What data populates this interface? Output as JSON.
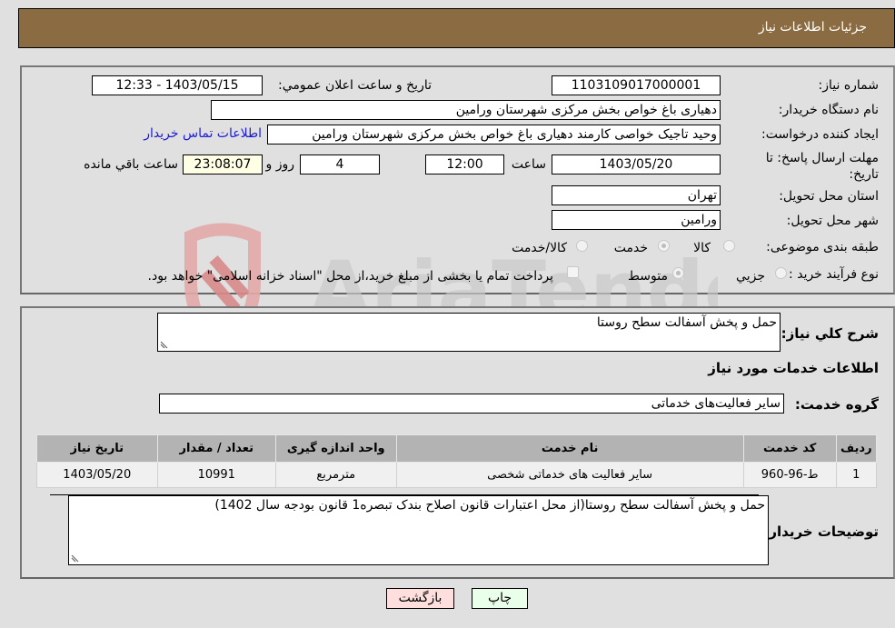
{
  "header": {
    "title": "جزئیات اطلاعات نیاز"
  },
  "fields": {
    "need_number": {
      "label": "شماره نیاز:",
      "value": "1103109017000001"
    },
    "announce_datetime": {
      "label": "تاریخ و ساعت اعلان عمومي:",
      "value": "1403/05/15 - 12:33"
    },
    "buyer_org": {
      "label": "نام دستگاه خريدار:",
      "value": "دهیاری باغ خواص بخش مرکزی شهرستان ورامین"
    },
    "requester": {
      "label": "ايجاد کننده درخواست:",
      "value": "وحید تاجیک خواصی کارمند دهیاری باغ خواص بخش مرکزی شهرستان ورامین"
    },
    "buyer_contact_link": "اطلاعات تماس خريدار",
    "deadline": {
      "label": "مهلت ارسال پاسخ: تا تاريخ:",
      "date": "1403/05/20",
      "time_label": "ساعت",
      "time": "12:00",
      "days": "4",
      "days_label": "روز و",
      "remaining": "23:08:07",
      "remaining_label": "ساعت باقي مانده"
    },
    "province": {
      "label": "استان محل تحویل:",
      "value": "تهران"
    },
    "city": {
      "label": "شهر محل تحویل:",
      "value": "ورامین"
    },
    "category": {
      "label": "طبقه بندی موضوعی:",
      "options": [
        "کالا",
        "خدمت",
        "کالا/خدمت"
      ],
      "selected": "خدمت"
    },
    "purchase_process": {
      "label": "نوع فرآیند خرید :",
      "options": [
        "جزيي",
        "متوسط"
      ],
      "selected": "متوسط",
      "treasury_checkbox_label": "پرداخت تمام یا بخشی از مبلغ خرید،از محل \"اسناد خزانه اسلامی\" خواهد بود.",
      "treasury_checked": false
    }
  },
  "description": {
    "label": "شرح کلي نياز:",
    "value": "حمل و پخش آسفالت سطح روستا"
  },
  "services_section": {
    "title": "اطلاعات خدمات مورد نياز"
  },
  "service_group": {
    "label": "گروه خدمت:",
    "value": "سایر فعالیت‌های خدماتی"
  },
  "table": {
    "headers": [
      "رديف",
      "کد خدمت",
      "نام خدمت",
      "واحد اندازه گیری",
      "تعداد / مقدار",
      "تاریخ نیاز"
    ],
    "rows": [
      [
        "1",
        "ط-96-960",
        "سایر فعالیت های خدماتی شخصی",
        "مترمربع",
        "10991",
        "1403/05/20"
      ]
    ]
  },
  "buyer_notes": {
    "label": "توضیحات خریدار:",
    "value": "حمل و پخش آسفالت سطح روستا(از محل اعتبارات قانون اصلاح بندک تبصره1 قانون بودجه سال 1402)"
  },
  "buttons": {
    "print": "چاپ",
    "back": "بازگشت"
  },
  "watermark": {
    "text": "AriaTender.neT"
  }
}
